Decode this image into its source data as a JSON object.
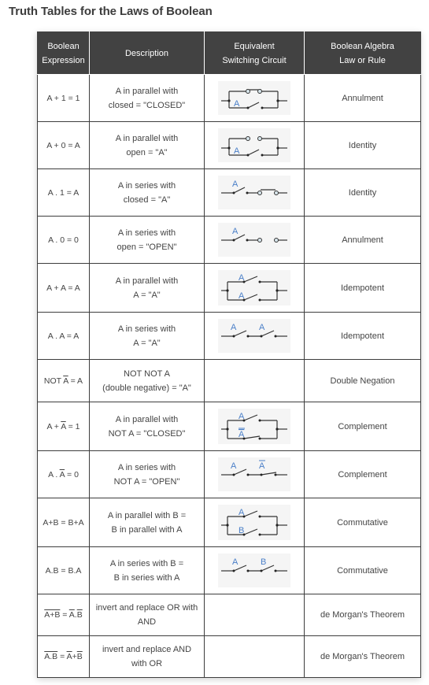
{
  "page": {
    "title": "Truth Tables for the Laws of Boolean"
  },
  "table": {
    "headers": {
      "expression_line1": "Boolean",
      "expression_line2": "Expression",
      "description": "Description",
      "circuit_line1": "Equivalent",
      "circuit_line2": "Switching Circuit",
      "law_line1": "Boolean Algebra",
      "law_line2": "Law or Rule"
    },
    "rows": [
      {
        "expr": "A + 1 = 1",
        "desc1": "A in parallel with",
        "desc2": "closed = \"CLOSED\"",
        "circuit": "parallel-A-closed",
        "law": "Annulment"
      },
      {
        "expr": "A + 0 = A",
        "desc1": "A in parallel with",
        "desc2": "open = \"A\"",
        "circuit": "parallel-A-open",
        "law": "Identity"
      },
      {
        "expr": "A . 1 = A",
        "desc1": "A in series with",
        "desc2": "closed = \"A\"",
        "circuit": "series-A-closed",
        "law": "Identity"
      },
      {
        "expr": "A . 0 = 0",
        "desc1": "A in series with",
        "desc2": "open = \"OPEN\"",
        "circuit": "series-A-open",
        "law": "Annulment"
      },
      {
        "expr": "A + A = A",
        "desc1": "A in parallel with",
        "desc2": "A = \"A\"",
        "circuit": "parallel-A-A",
        "law": "Idempotent"
      },
      {
        "expr": "A . A = A",
        "desc1": "A in series with",
        "desc2": "A = \"A\"",
        "circuit": "series-A-A",
        "law": "Idempotent"
      },
      {
        "expr_parts": [
          "NOT ",
          "A",
          " = A"
        ],
        "desc1": "NOT NOT A",
        "desc2": "(double negative) = \"A\"",
        "circuit": "none",
        "law": "Double Negation"
      },
      {
        "expr_parts": [
          "A + ",
          "A",
          " = 1"
        ],
        "desc1": "A in parallel with",
        "desc2": "NOT A = \"CLOSED\"",
        "circuit": "parallel-A-notA",
        "law": "Complement"
      },
      {
        "expr_parts": [
          "A . ",
          "A",
          " = 0"
        ],
        "desc1": "A in series with",
        "desc2": "NOT A = \"OPEN\"",
        "circuit": "series-A-notA",
        "law": "Complement"
      },
      {
        "expr": "A+B = B+A",
        "desc1": "A in parallel with B =",
        "desc2": "B in parallel with A",
        "circuit": "parallel-A-B",
        "law": "Commutative"
      },
      {
        "expr": "A.B = B.A",
        "desc1": "A in series with B =",
        "desc2": "B in series with A",
        "circuit": "series-A-B",
        "law": "Commutative"
      },
      {
        "expr_parts": [
          "A+B",
          " = ",
          "A",
          ".",
          "B"
        ],
        "desc1": "invert and replace OR with",
        "desc2": "AND",
        "circuit": "none",
        "law": "de Morgan's Theorem"
      },
      {
        "expr_parts": [
          "A.B",
          " = ",
          "A",
          "+",
          "B"
        ],
        "desc1": "invert and replace AND",
        "desc2": "with OR",
        "circuit": "none",
        "law": "de Morgan's Theorem"
      }
    ],
    "circuit_labels": {
      "a": "A",
      "b": "B",
      "not_a": "A"
    },
    "colors": {
      "header_bg": "#424242",
      "label_blue": "#4a7fc8",
      "contact_fill": "#d8e6ec"
    }
  }
}
